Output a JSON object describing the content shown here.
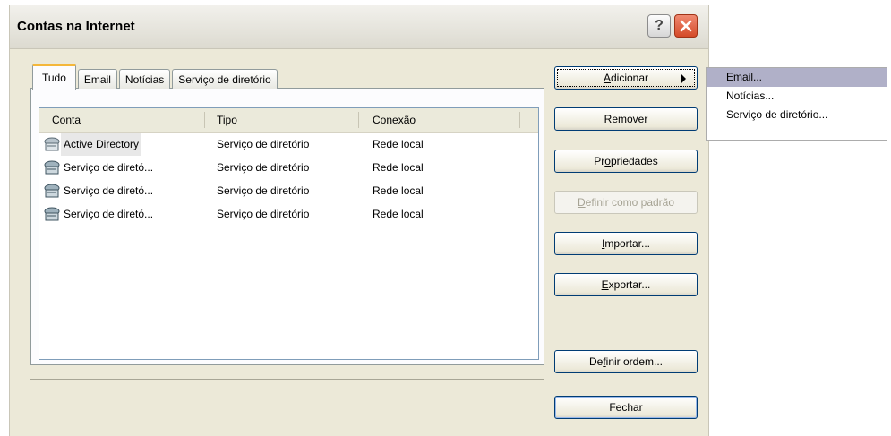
{
  "window": {
    "title": "Contas na Internet",
    "help_label": "?"
  },
  "tabs": [
    {
      "label": "Tudo",
      "active": true
    },
    {
      "label": "Email",
      "active": false
    },
    {
      "label": "Notícias",
      "active": false
    },
    {
      "label": "Serviço de diretório",
      "active": false
    }
  ],
  "table": {
    "columns": [
      "Conta",
      "Tipo",
      "Conexão"
    ],
    "rows": [
      {
        "account": "Active Directory",
        "type": "Serviço de diretório",
        "connection": "Rede local"
      },
      {
        "account": "Serviço de diretó...",
        "type": "Serviço de diretório",
        "connection": "Rede local"
      },
      {
        "account": "Serviço de diretó...",
        "type": "Serviço de diretório",
        "connection": "Rede local"
      },
      {
        "account": "Serviço de diretó...",
        "type": "Serviço de diretório",
        "connection": "Rede local"
      }
    ]
  },
  "buttons": {
    "add": {
      "pre": "",
      "accel": "A",
      "post": "dicionar"
    },
    "remove": {
      "pre": "",
      "accel": "R",
      "post": "emover"
    },
    "properties": {
      "pre": "Pr",
      "accel": "o",
      "post": "priedades"
    },
    "set_default": {
      "pre": "",
      "accel": "D",
      "post": "efinir como padrão"
    },
    "import": {
      "pre": "",
      "accel": "I",
      "post": "mportar..."
    },
    "export": {
      "pre": "",
      "accel": "E",
      "post": "xportar..."
    },
    "set_order": {
      "pre": "De",
      "accel": "f",
      "post": "inir ordem..."
    },
    "close": "Fechar"
  },
  "submenu": {
    "items": [
      "Email...",
      "Notícias...",
      "Serviço de diretório..."
    ],
    "highlighted_index": 0
  },
  "colors": {
    "dialog_bg": "#ece9d8",
    "active_tab_accent": "#f4b73a",
    "button_border": "#003c74",
    "menu_highlight": "#b0b0c8"
  }
}
